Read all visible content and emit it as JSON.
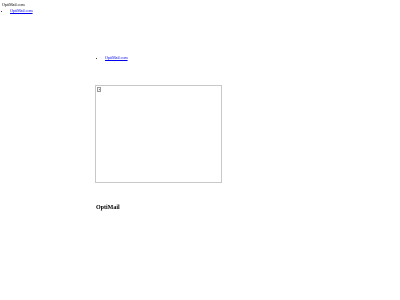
{
  "header": {
    "site_name": "OptiMail.com"
  },
  "nav": {
    "items": [
      {
        "label": "OptiMail.com"
      }
    ]
  },
  "main": {
    "links": [
      {
        "label": "OptiMail.com"
      }
    ],
    "image": {
      "state": "broken-image",
      "icon": "broken-image-icon"
    },
    "heading": "OptiMail"
  }
}
